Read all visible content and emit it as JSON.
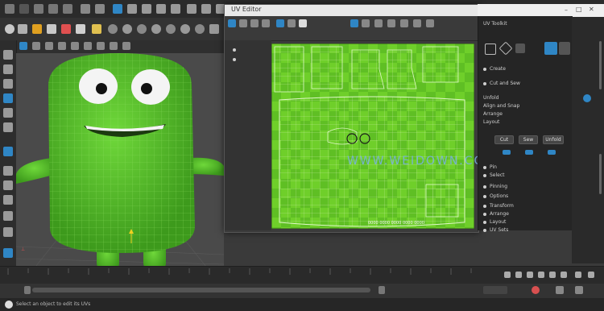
{
  "app": {
    "watermark": "WWW.WEIDOWN.COM"
  },
  "uv_editor": {
    "title": "UV Editor",
    "info_line": "0000 0000 0000 0000 0000"
  },
  "attribute_panel": {
    "title": "UV Toolkit",
    "rows": [
      "Create",
      "Cut and Sew",
      "Unfold",
      "Align and Snap",
      "Arrange",
      "Layout"
    ],
    "buttons": [
      "Cut",
      "Sew",
      "Unfold"
    ],
    "list": [
      "Pin",
      "Select",
      "Pinning",
      "Options",
      "Transform",
      "Arrange",
      "Layout",
      "UV Sets"
    ]
  },
  "timeline": {
    "start_frame": "1",
    "frame_numbers": [
      "5",
      "10",
      "15",
      "20",
      "25",
      "30",
      "35",
      "40",
      "45",
      "50",
      "55",
      "60",
      "65",
      "70",
      "75",
      "80",
      "85",
      "90",
      "95",
      "100",
      "105",
      "110",
      "115",
      "120"
    ]
  },
  "status": {
    "text": "Select an object to edit its UVs"
  },
  "colors": {
    "accent": "#2f86c5",
    "uv_green": "#6fcf2a",
    "character_green": "#5cbf2a"
  }
}
